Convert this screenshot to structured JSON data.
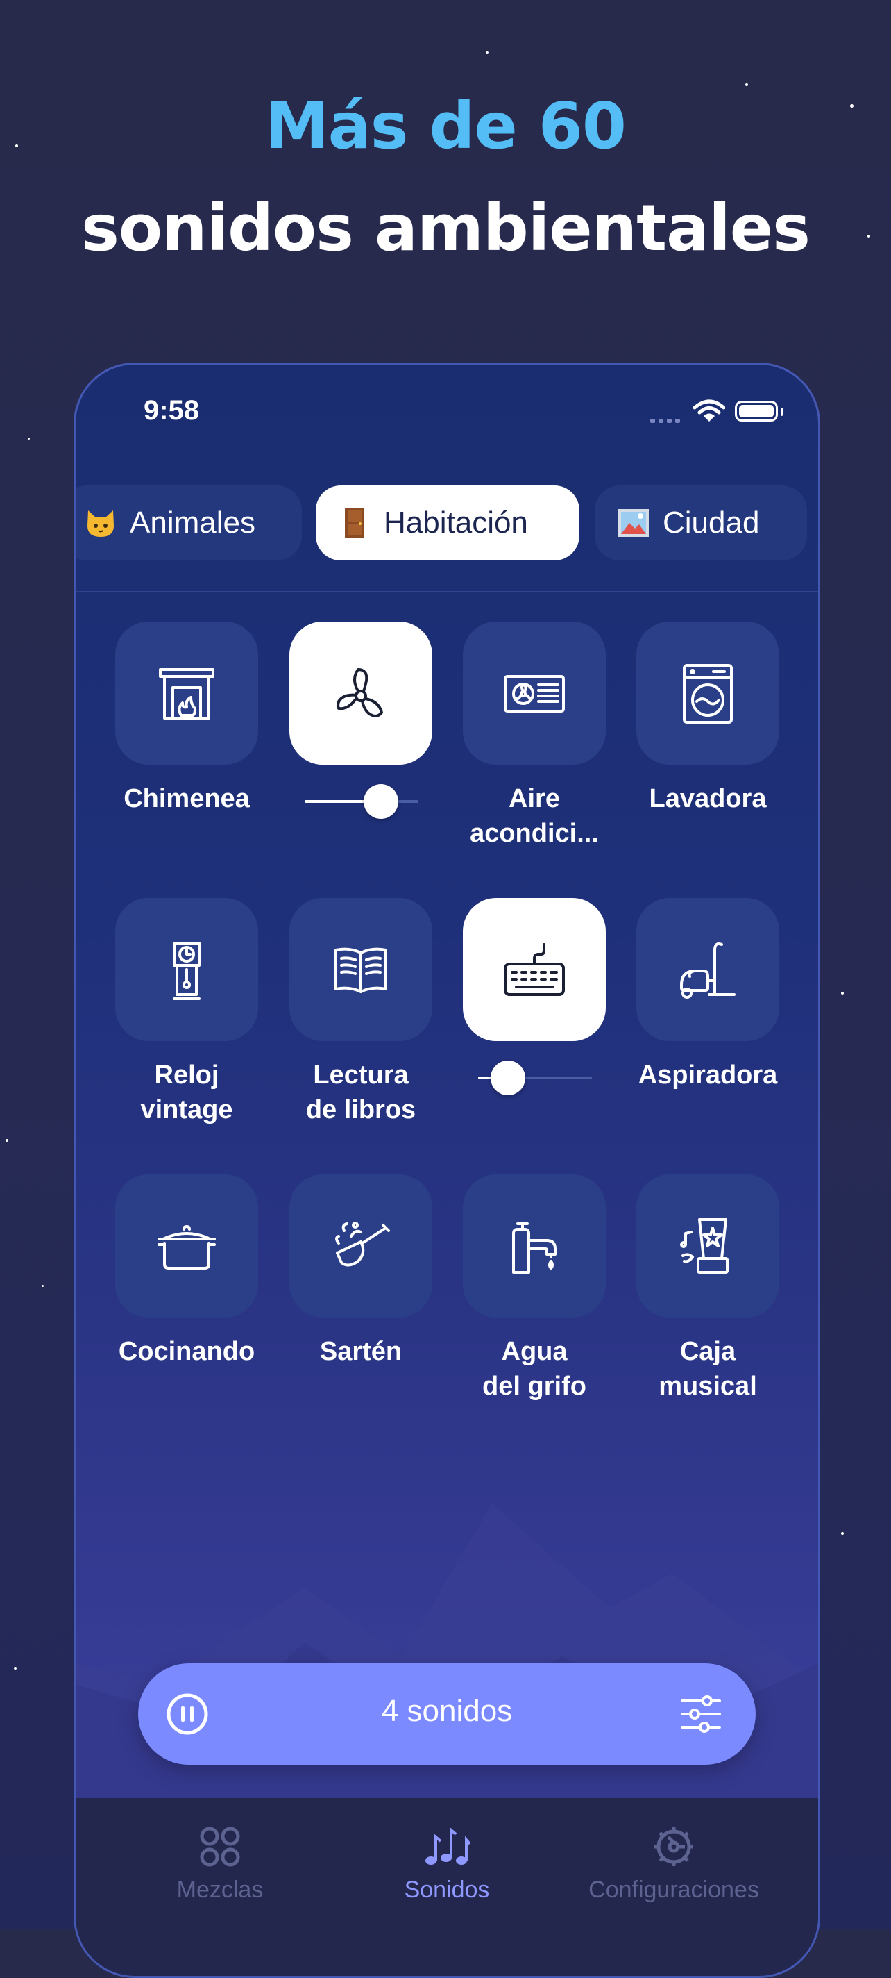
{
  "headline": {
    "line1": "Más de 60",
    "line2": "sonidos ambientales"
  },
  "status_bar": {
    "time": "9:58"
  },
  "categories": [
    {
      "label": "Animales",
      "icon": "cat-emoji",
      "active": false
    },
    {
      "label": "Habitación",
      "icon": "door-emoji",
      "active": true
    },
    {
      "label": "Ciudad",
      "icon": "city-picture-emoji",
      "active": false
    }
  ],
  "sounds": [
    {
      "label": "Chimenea",
      "icon": "fireplace-icon",
      "active": false
    },
    {
      "label": "",
      "icon": "fan-icon",
      "active": true,
      "volume": 0.55
    },
    {
      "label": "Aire acondici...",
      "icon": "air-conditioner-icon",
      "active": false
    },
    {
      "label": "Lavadora",
      "icon": "washing-machine-icon",
      "active": false
    },
    {
      "label": "Reloj vintage",
      "icon": "grandfather-clock-icon",
      "active": false
    },
    {
      "label": "Lectura de libros",
      "icon": "open-book-icon",
      "active": false
    },
    {
      "label": "",
      "icon": "keyboard-icon",
      "active": true,
      "volume": 0.2
    },
    {
      "label": "Aspiradora",
      "icon": "vacuum-cleaner-icon",
      "active": false
    },
    {
      "label": "Cocinando",
      "icon": "cooking-pot-icon",
      "active": false
    },
    {
      "label": "Sartén",
      "icon": "frying-pan-icon",
      "active": false
    },
    {
      "label": "Agua del grifo",
      "icon": "faucet-icon",
      "active": false
    },
    {
      "label": "Caja musical",
      "icon": "music-box-icon",
      "active": false
    }
  ],
  "player": {
    "label": "4 sonidos"
  },
  "tab_bar": [
    {
      "label": "Mezclas",
      "icon": "mixes-grid-icon",
      "active": false
    },
    {
      "label": "Sonidos",
      "icon": "music-notes-icon",
      "active": true
    },
    {
      "label": "Configuraciones",
      "icon": "settings-gear-icon",
      "active": false
    }
  ],
  "colors": {
    "accent": "#7b8bff",
    "headline_accent": "#55bdf6",
    "tile": "#2a3f87"
  }
}
